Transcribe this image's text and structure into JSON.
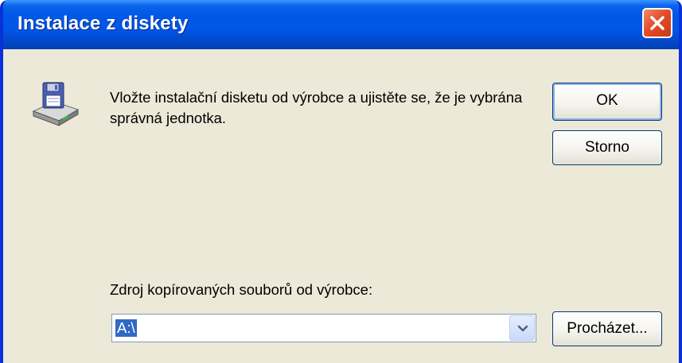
{
  "dialog": {
    "title": "Instalace z diskety",
    "message": "Vložte instalační disketu od výrobce a ujistěte se, že je vybrána správná jednotka.",
    "ok_label": "OK",
    "cancel_label": "Storno",
    "source_label": "Zdroj kopírovaných souborů od výrobce:",
    "source_value": "A:\\",
    "browse_label": "Procházet...",
    "icons": {
      "main": "floppy-drive-icon",
      "close": "close-icon",
      "dropdown": "chevron-down-icon"
    },
    "colors": {
      "title_bar": "#0058e6",
      "close_button": "#e34d2a",
      "dialog_background": "#ece9d8",
      "selection": "#316ac5"
    }
  }
}
